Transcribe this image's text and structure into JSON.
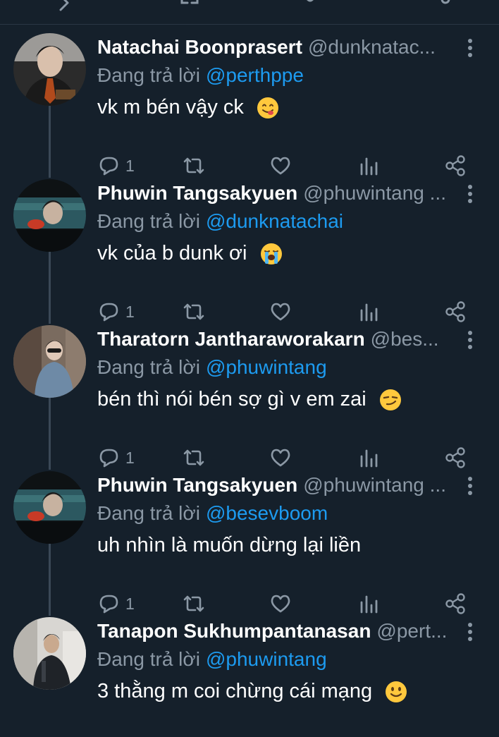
{
  "reply_prefix": "Đang trả lời",
  "tweets": [
    {
      "name": "Natachai Boonprasert",
      "handle": "@dunknatac...",
      "reply_to": "@perthppe",
      "text": "vk m bén vậy ck",
      "emoji": "face-savoring-emoji",
      "reply_count": "1"
    },
    {
      "name": "Phuwin Tangsakyuen",
      "handle": "@phuwintang ...",
      "reply_to": "@dunknatachai",
      "text": "vk của b dunk ơi",
      "emoji": "loudly-crying-face-emoji",
      "reply_count": "1"
    },
    {
      "name": "Tharatorn Jantharaworakarn",
      "handle": "@bes...",
      "reply_to": "@phuwintang",
      "text": "bén thì nói bén sợ gì v em zai",
      "emoji": "smirking-face-emoji",
      "reply_count": "1"
    },
    {
      "name": "Phuwin Tangsakyuen",
      "handle": "@phuwintang ...",
      "reply_to": "@besevboom",
      "text": "uh nhìn là muốn dừng lại liền",
      "emoji": "",
      "reply_count": "1"
    },
    {
      "name": "Tanapon Sukhumpantanasan",
      "handle": "@pert...",
      "reply_to": "@phuwintang",
      "text": "3 thằng m coi chừng cái mạng",
      "emoji": "slightly-smiling-face-emoji",
      "reply_count": ""
    }
  ],
  "colors": {
    "background": "#15202b",
    "muted": "#8b98a5",
    "mention": "#1d9bf0",
    "text": "#ffffff"
  }
}
